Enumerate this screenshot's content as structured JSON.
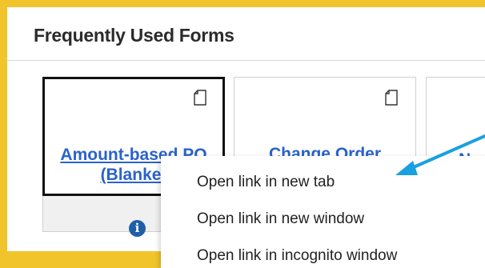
{
  "panel": {
    "title": "Frequently Used Forms"
  },
  "tiles": [
    {
      "line1": "Amount-based PO",
      "line2": "(Blanket"
    },
    {
      "line1": "Change Order",
      "line2": ""
    },
    {
      "line1": "N",
      "line2": ""
    }
  ],
  "context_menu": {
    "items": [
      "Open link in new tab",
      "Open link in new window",
      "Open link in incognito window"
    ]
  },
  "colors": {
    "frame": "#f2c42b",
    "link": "#2a62c9",
    "info_icon": "#1f5fa8",
    "arrow": "#1aa0e0"
  },
  "icons": [
    "document-icon",
    "info-icon",
    "arrow-annotation"
  ]
}
